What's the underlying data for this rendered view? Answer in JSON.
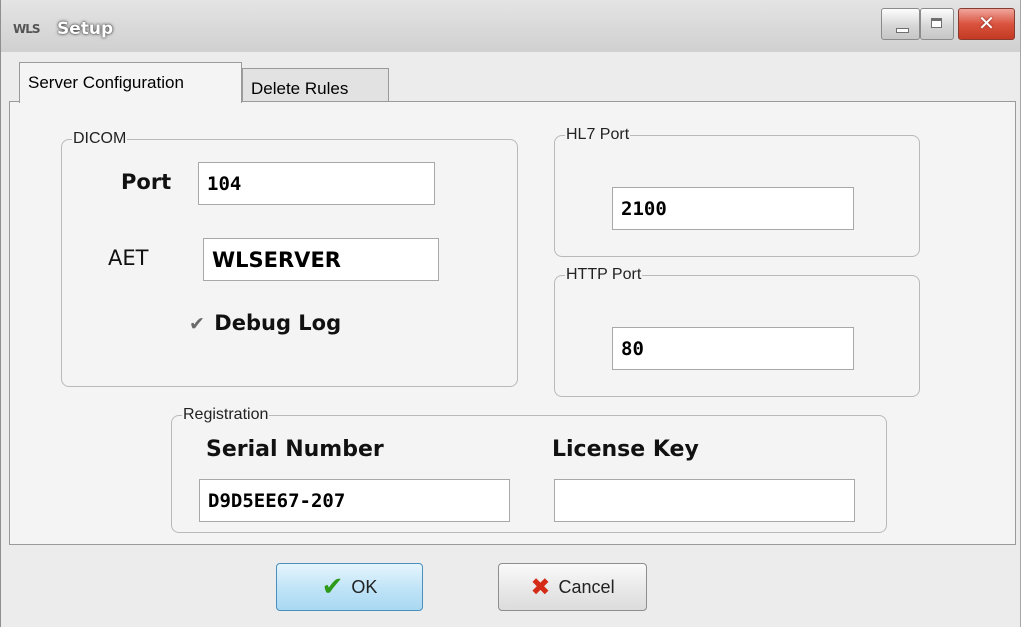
{
  "window": {
    "title": "Setup",
    "app_icon_text": "WLS"
  },
  "tabs": [
    {
      "label": "Server Configuration",
      "active": true
    },
    {
      "label": "Delete Rules",
      "active": false
    }
  ],
  "dicom": {
    "legend": "DICOM",
    "port_label": "Port",
    "port_value": "104",
    "aet_label": "AET",
    "aet_value": "WLSERVER",
    "debug_log_label": "Debug Log",
    "debug_log_checked": true
  },
  "hl7": {
    "legend": "HL7 Port",
    "value": "2100"
  },
  "http": {
    "legend": "HTTP Port",
    "value": "80"
  },
  "registration": {
    "legend": "Registration",
    "serial_label": "Serial Number",
    "serial_value": "D9D5EE67-207",
    "license_label": "License Key",
    "license_value": ""
  },
  "buttons": {
    "ok_label": "OK",
    "cancel_label": "Cancel"
  },
  "icons": {
    "ok": "checkmark-icon",
    "cancel": "x-icon",
    "close": "close-icon",
    "minimize": "minimize-icon",
    "maximize": "maximize-icon"
  },
  "colors": {
    "ok_check": "#2e9a1a",
    "cancel_x": "#d42b16",
    "close_button": "#d9533f",
    "ok_button_bg": "#bfe3f7"
  }
}
